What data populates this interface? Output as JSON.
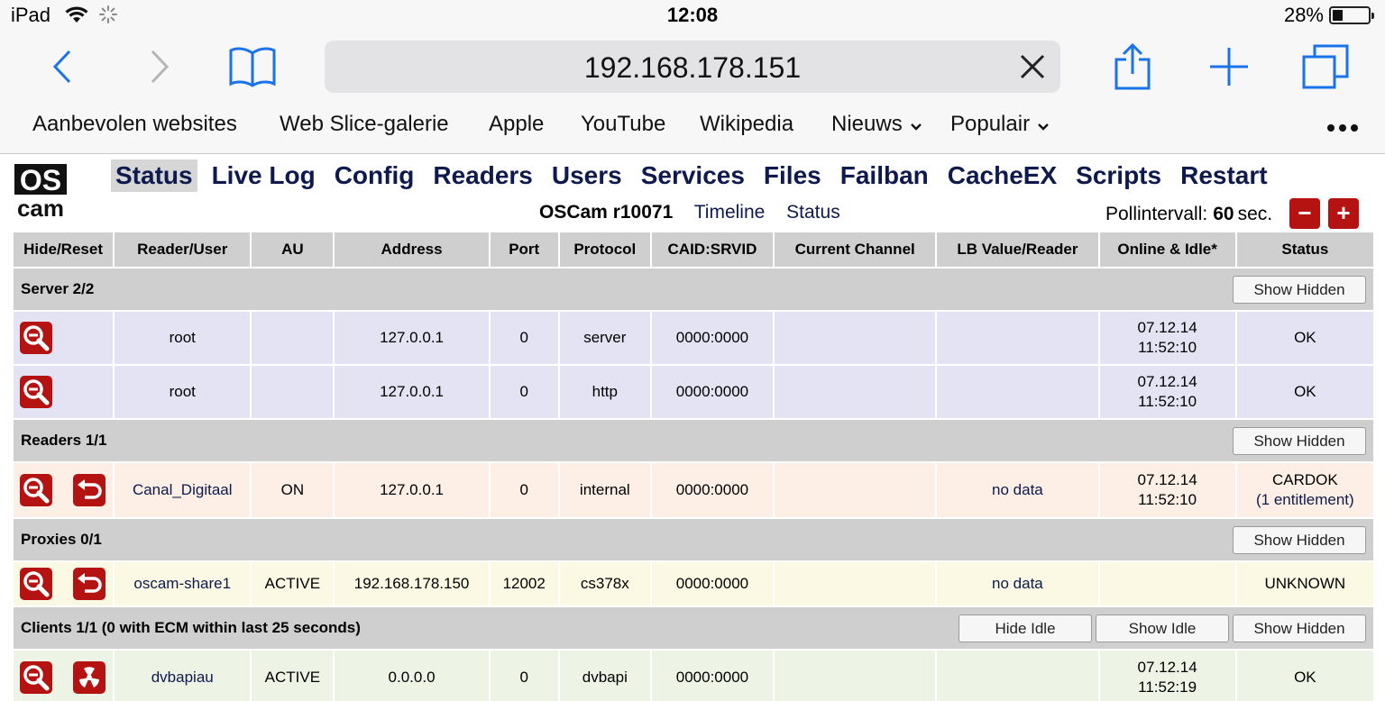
{
  "status_bar": {
    "device": "iPad",
    "time": "12:08",
    "battery": "28%",
    "battery_level": 0.28
  },
  "browser": {
    "url": "192.168.178.151",
    "favorites": [
      "Aanbevolen websites",
      "Web Slice-galerie",
      "Apple",
      "YouTube",
      "Wikipedia",
      "Nieuws",
      "Populair"
    ]
  },
  "oscam": {
    "logo_text": [
      "OS",
      "cam"
    ],
    "menu": [
      "Status",
      "Live Log",
      "Config",
      "Readers",
      "Users",
      "Services",
      "Files",
      "Failban",
      "CacheEX",
      "Scripts",
      "Restart"
    ],
    "active_menu": "Status",
    "version": "OSCam r10071",
    "sub_links": [
      "Timeline",
      "Status"
    ],
    "poll_label": "Pollintervall:",
    "poll_value": "60",
    "poll_unit": "sec.",
    "poll_minus": "−",
    "poll_plus": "+",
    "accent_color": "#b51212"
  },
  "table": {
    "headers": [
      "Hide/Reset",
      "Reader/User",
      "AU",
      "Address",
      "Port",
      "Protocol",
      "CAID:SRVID",
      "Current Channel",
      "LB Value/Reader",
      "Online & Idle*",
      "Status"
    ],
    "sections": {
      "server": {
        "title": "Server 2/2",
        "buttons": [
          "Show Hidden"
        ]
      },
      "readers": {
        "title": "Readers 1/1",
        "buttons": [
          "Show Hidden"
        ]
      },
      "proxies": {
        "title": "Proxies 0/1",
        "buttons": [
          "Show Hidden"
        ]
      },
      "clients": {
        "title": "Clients 1/1 (0 with ECM within last 25 seconds)",
        "buttons": [
          "Hide Idle",
          "Show Idle",
          "Show Hidden"
        ]
      }
    },
    "server_rows": [
      {
        "user": "root",
        "au": "",
        "address": "127.0.0.1",
        "port": "0",
        "protocol": "server",
        "caid": "0000:0000",
        "channel": "",
        "lb": "",
        "online_date": "07.12.14",
        "online_time": "11:52:10",
        "status": "OK"
      },
      {
        "user": "root",
        "au": "",
        "address": "127.0.0.1",
        "port": "0",
        "protocol": "http",
        "caid": "0000:0000",
        "channel": "",
        "lb": "",
        "online_date": "07.12.14",
        "online_time": "11:52:10",
        "status": "OK"
      }
    ],
    "reader_rows": [
      {
        "user": "Canal_Digitaal",
        "au": "ON",
        "address": "127.0.0.1",
        "port": "0",
        "protocol": "internal",
        "caid": "0000:0000",
        "channel": "",
        "lb": "no data",
        "online_date": "07.12.14",
        "online_time": "11:52:10",
        "status": "CARDOK",
        "status_detail": "(1 entitlement)"
      }
    ],
    "proxy_rows": [
      {
        "user": "oscam-share1",
        "au": "ACTIVE",
        "address": "192.168.178.150",
        "port": "12002",
        "protocol": "cs378x",
        "caid": "0000:0000",
        "channel": "",
        "lb": "no data",
        "online_date": "",
        "online_time": "",
        "status": "UNKNOWN"
      }
    ],
    "client_rows": [
      {
        "user": "dvbapiau",
        "au": "ACTIVE",
        "address": "0.0.0.0",
        "port": "0",
        "protocol": "dvbapi",
        "caid": "0000:0000",
        "channel": "",
        "lb": "",
        "online_date": "07.12.14",
        "online_time": "11:52:19",
        "status": "OK"
      }
    ]
  }
}
